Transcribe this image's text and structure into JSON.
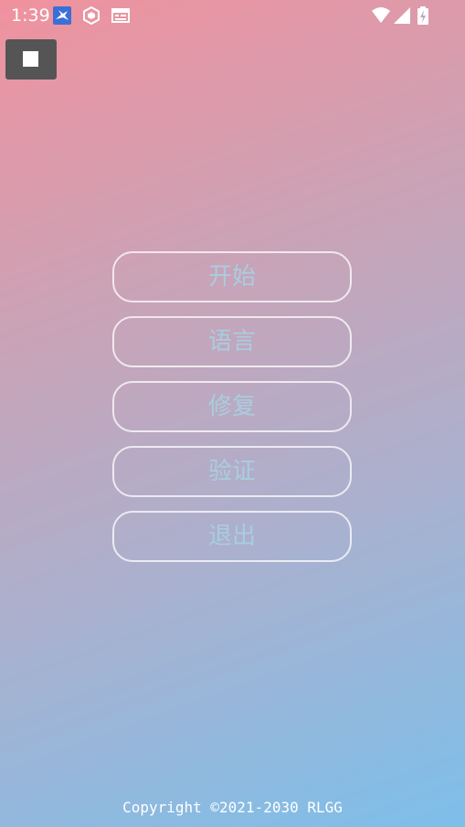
{
  "status_bar": {
    "time": "1:39",
    "icons": [
      "bird-app-icon",
      "cube-app-icon",
      "calendar-app-icon"
    ],
    "right_icons": [
      "wifi-icon",
      "signal-icon",
      "battery-charging-icon"
    ]
  },
  "stop_button": {
    "icon": "stop-icon"
  },
  "menu": {
    "items": [
      {
        "label": "开始"
      },
      {
        "label": "语言"
      },
      {
        "label": "修复"
      },
      {
        "label": "验证"
      },
      {
        "label": "退出"
      }
    ]
  },
  "footer": {
    "copyright": "Copyright ©2021-2030 RLGG"
  },
  "colors": {
    "button_text": "#a9cde0",
    "button_border": "#ffffff",
    "gradient_start": "#f0929e",
    "gradient_end": "#7dbfea"
  }
}
